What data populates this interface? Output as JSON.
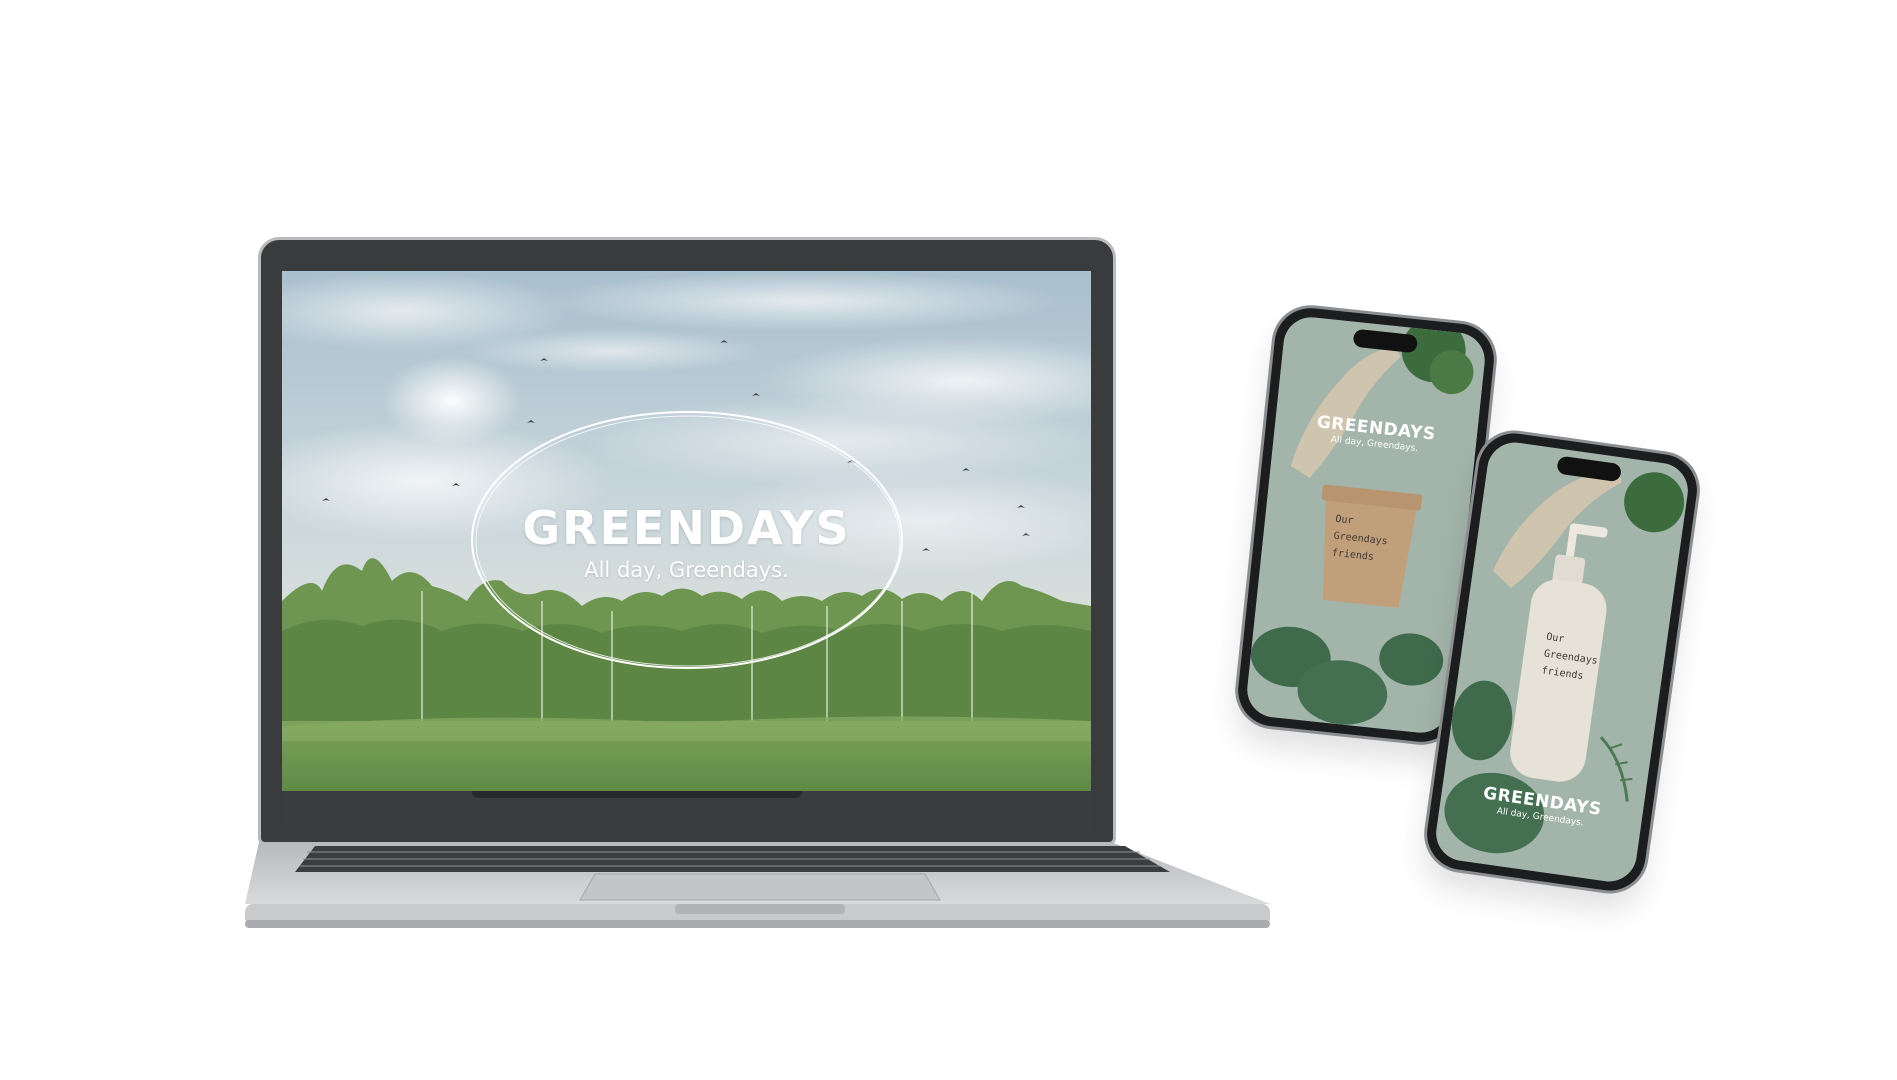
{
  "laptop": {
    "hero": {
      "title": "GREENDAYS",
      "subtitle": "All day, Greendays."
    }
  },
  "phone_a": {
    "title": "GREENDAYS",
    "subtitle": "All day, Greendays.",
    "product": {
      "label_lines": [
        "Our",
        "Greendays",
        "friends"
      ]
    }
  },
  "phone_b": {
    "title": "GREENDAYS",
    "subtitle": "All day, Greendays.",
    "product": {
      "label_lines": [
        "Our",
        "Greendays",
        "friends"
      ]
    }
  },
  "colors": {
    "background": "#ffffff",
    "sky": "#b9c9d2",
    "forest": "#5f8a45",
    "phone_screen": "#9fb2a8",
    "jar": "#c4a27f",
    "bottle": "#e6e2d8"
  }
}
